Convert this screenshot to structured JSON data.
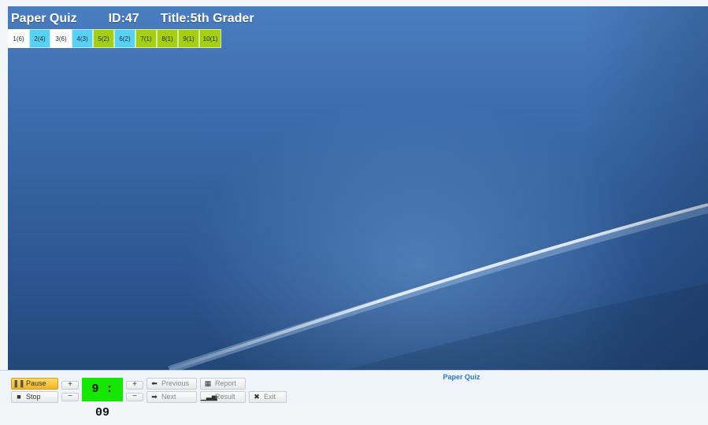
{
  "header": {
    "app_name": "Paper Quiz",
    "id_label": "ID:47",
    "title_label": "Title:5th Grader"
  },
  "question_tabs": [
    {
      "label": "1(6)",
      "color": "#ffffff"
    },
    {
      "label": "2(4)",
      "color": "#59d1f5"
    },
    {
      "label": "3(6)",
      "color": "#ffffff"
    },
    {
      "label": "4(3)",
      "color": "#59d1f5"
    },
    {
      "label": "5(2)",
      "color": "#a6cf12"
    },
    {
      "label": "6(2)",
      "color": "#59d1f5"
    },
    {
      "label": "7(1)",
      "color": "#a6cf12"
    },
    {
      "label": "8(1)",
      "color": "#a6cf12"
    },
    {
      "label": "9(1)",
      "color": "#a6cf12"
    },
    {
      "label": "10(1)",
      "color": "#a6cf12"
    }
  ],
  "controls": {
    "pause_label": "Pause",
    "stop_label": "Stop",
    "timer": "9 : 09",
    "plus": "+",
    "minus": "−",
    "previous_label": "Previous",
    "next_label": "Next",
    "report_label": "Report",
    "result_label": "Result",
    "exit_label": "Exit"
  },
  "footer": {
    "title": "Paper Quiz"
  },
  "colors": {
    "accent_blue": "#2a78d4",
    "timer_green": "#17e600",
    "pause_yellow": "#f2b620"
  }
}
